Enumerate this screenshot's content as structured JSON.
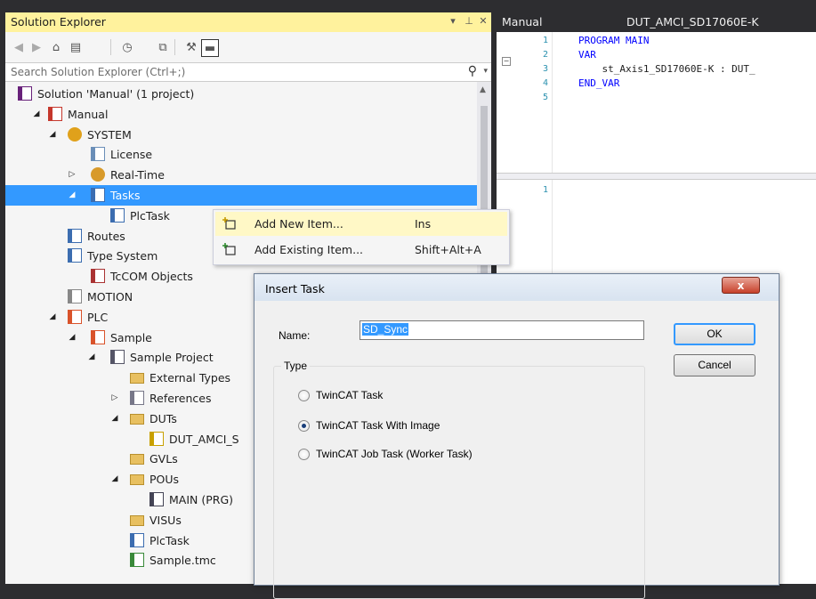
{
  "solution_explorer": {
    "title": "Solution Explorer",
    "title_buttons": [
      "▾",
      "⊥",
      "✕"
    ],
    "search_placeholder": "Search Solution Explorer (Ctrl+;)",
    "tree": [
      {
        "label": "Solution 'Manual' (1 project)",
        "icon": "solution-icon",
        "toggle": ""
      },
      {
        "label": "Manual",
        "icon": "project-icon",
        "toggle": "◢"
      },
      {
        "label": "SYSTEM",
        "icon": "system-icon",
        "toggle": "◢"
      },
      {
        "label": "License",
        "icon": "license-icon",
        "toggle": ""
      },
      {
        "label": "Real-Time",
        "icon": "realtime-icon",
        "toggle": "▷"
      },
      {
        "label": "Tasks",
        "icon": "tasks-icon",
        "toggle": "◢",
        "selected": true
      },
      {
        "label": "PlcTask",
        "icon": "task-icon",
        "toggle": ""
      },
      {
        "label": "Routes",
        "icon": "routes-icon",
        "toggle": ""
      },
      {
        "label": "Type System",
        "icon": "type-system-icon",
        "toggle": ""
      },
      {
        "label": "TcCOM Objects",
        "icon": "tccom-icon",
        "toggle": ""
      },
      {
        "label": "MOTION",
        "icon": "motion-icon",
        "toggle": ""
      },
      {
        "label": "PLC",
        "icon": "plc-icon",
        "toggle": "◢"
      },
      {
        "label": "Sample",
        "icon": "plc-project-icon",
        "toggle": "◢"
      },
      {
        "label": "Sample Project",
        "icon": "plc-sample-icon",
        "toggle": "◢"
      },
      {
        "label": "External Types",
        "icon": "folder-icon",
        "toggle": ""
      },
      {
        "label": "References",
        "icon": "references-icon",
        "toggle": "▷"
      },
      {
        "label": "DUTs",
        "icon": "folder-open-icon",
        "toggle": "◢"
      },
      {
        "label": "DUT_AMCI_S",
        "icon": "dut-icon",
        "toggle": ""
      },
      {
        "label": "GVLs",
        "icon": "folder-icon",
        "toggle": ""
      },
      {
        "label": "POUs",
        "icon": "folder-open-icon",
        "toggle": "◢"
      },
      {
        "label": "MAIN (PRG)",
        "icon": "pou-icon",
        "toggle": ""
      },
      {
        "label": "VISUs",
        "icon": "folder-icon",
        "toggle": ""
      },
      {
        "label": "PlcTask",
        "icon": "task-icon",
        "toggle": ""
      },
      {
        "label": "Sample.tmc",
        "icon": "tmc-icon",
        "toggle": ""
      }
    ]
  },
  "editor": {
    "tab_left": "Manual",
    "tab_right": "DUT_AMCI_SD17060E-K",
    "top_pane": {
      "line_numbers": [
        "1",
        "2",
        "3",
        "4",
        "5"
      ],
      "lines": [
        "PROGRAM MAIN",
        "VAR",
        "    st_Axis1_SD17060E-K : DUT_",
        "END_VAR",
        ""
      ]
    },
    "bottom_pane": {
      "line_numbers": [
        "1"
      ]
    }
  },
  "context_menu": {
    "items": [
      {
        "label": "Add New Item...",
        "shortcut": "Ins",
        "icon": "add-new-item-icon"
      },
      {
        "label": "Add Existing Item...",
        "shortcut": "Shift+Alt+A",
        "icon": "add-existing-item-icon"
      }
    ]
  },
  "dialog": {
    "title": "Insert Task",
    "close_label": "x",
    "name_label": "Name:",
    "name_value": "SD_Sync",
    "ok_label": "OK",
    "cancel_label": "Cancel",
    "type_legend": "Type",
    "options": [
      {
        "label": "TwinCAT Task",
        "checked": false
      },
      {
        "label": "TwinCAT Task With Image",
        "checked": true
      },
      {
        "label": "TwinCAT Job Task (Worker Task)",
        "checked": false
      }
    ]
  }
}
